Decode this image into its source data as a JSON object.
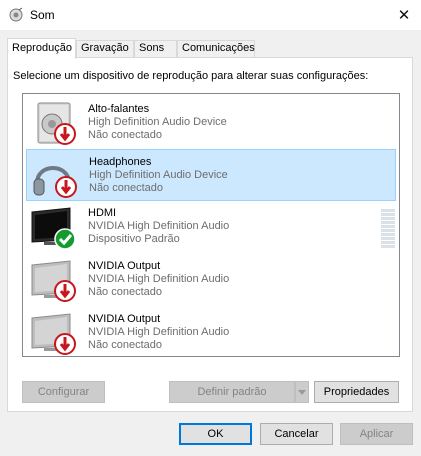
{
  "window": {
    "title": "Som",
    "close_glyph": "✕"
  },
  "tabs": [
    "Reprodução",
    "Gravação",
    "Sons",
    "Comunicações"
  ],
  "active_tab": "Reprodução",
  "instruction": "Selecione um dispositivo de reprodução para alterar suas configurações:",
  "devices": [
    {
      "name": "Alto-falantes",
      "driver": "High Definition Audio Device",
      "status": "Não conectado",
      "icon": "speaker-icon",
      "badge": "disconnected-badge-icon",
      "selected": false
    },
    {
      "name": "Headphones",
      "driver": "High Definition Audio Device",
      "status": "Não conectado",
      "icon": "headphones-icon",
      "badge": "disconnected-badge-icon",
      "selected": true
    },
    {
      "name": "HDMI",
      "driver": "NVIDIA High Definition Audio",
      "status": "Dispositivo Padrão",
      "icon": "monitor-icon",
      "badge": "default-check-badge-icon",
      "selected": false
    },
    {
      "name": "NVIDIA Output",
      "driver": "NVIDIA High Definition Audio",
      "status": "Não conectado",
      "icon": "monitor-icon",
      "badge": "disconnected-badge-icon",
      "selected": false
    },
    {
      "name": "NVIDIA Output",
      "driver": "NVIDIA High Definition Audio",
      "status": "Não conectado",
      "icon": "monitor-icon",
      "badge": "disconnected-badge-icon",
      "selected": false
    }
  ],
  "buttons": {
    "configure": "Configurar",
    "set_default": "Definir padrão",
    "properties": "Propriedades",
    "ok": "OK",
    "cancel": "Cancelar",
    "apply": "Aplicar"
  },
  "colors": {
    "selection_bg": "#cce8ff",
    "selection_border": "#99d1ff",
    "disconnected_badge": "#c7161e",
    "default_badge": "#139b2f",
    "default_button_border": "#0078d7"
  }
}
